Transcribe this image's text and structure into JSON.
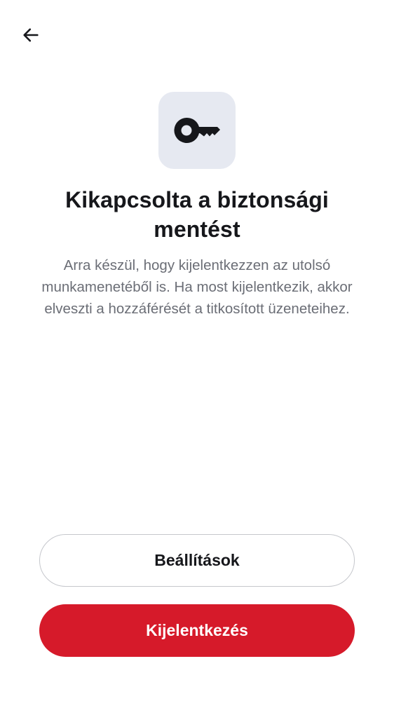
{
  "nav": {
    "back_icon": "arrow-left-icon"
  },
  "hero": {
    "icon": "key-icon",
    "icon_tile_color": "#e6e9f1"
  },
  "title": "Kikapcsolta a biztonsági mentést",
  "description": "Arra készül, hogy kijelentkezzen az utolsó munkamenetéből is. Ha most kijelentkezik, akkor elveszti a hozzáférését a titkosított üzeneteihez.",
  "buttons": {
    "settings_label": "Beállítások",
    "logout_label": "Kijelentkezés"
  },
  "colors": {
    "accent": "#d61a2a",
    "text_primary": "#16171b",
    "text_secondary": "#6b6e76"
  }
}
